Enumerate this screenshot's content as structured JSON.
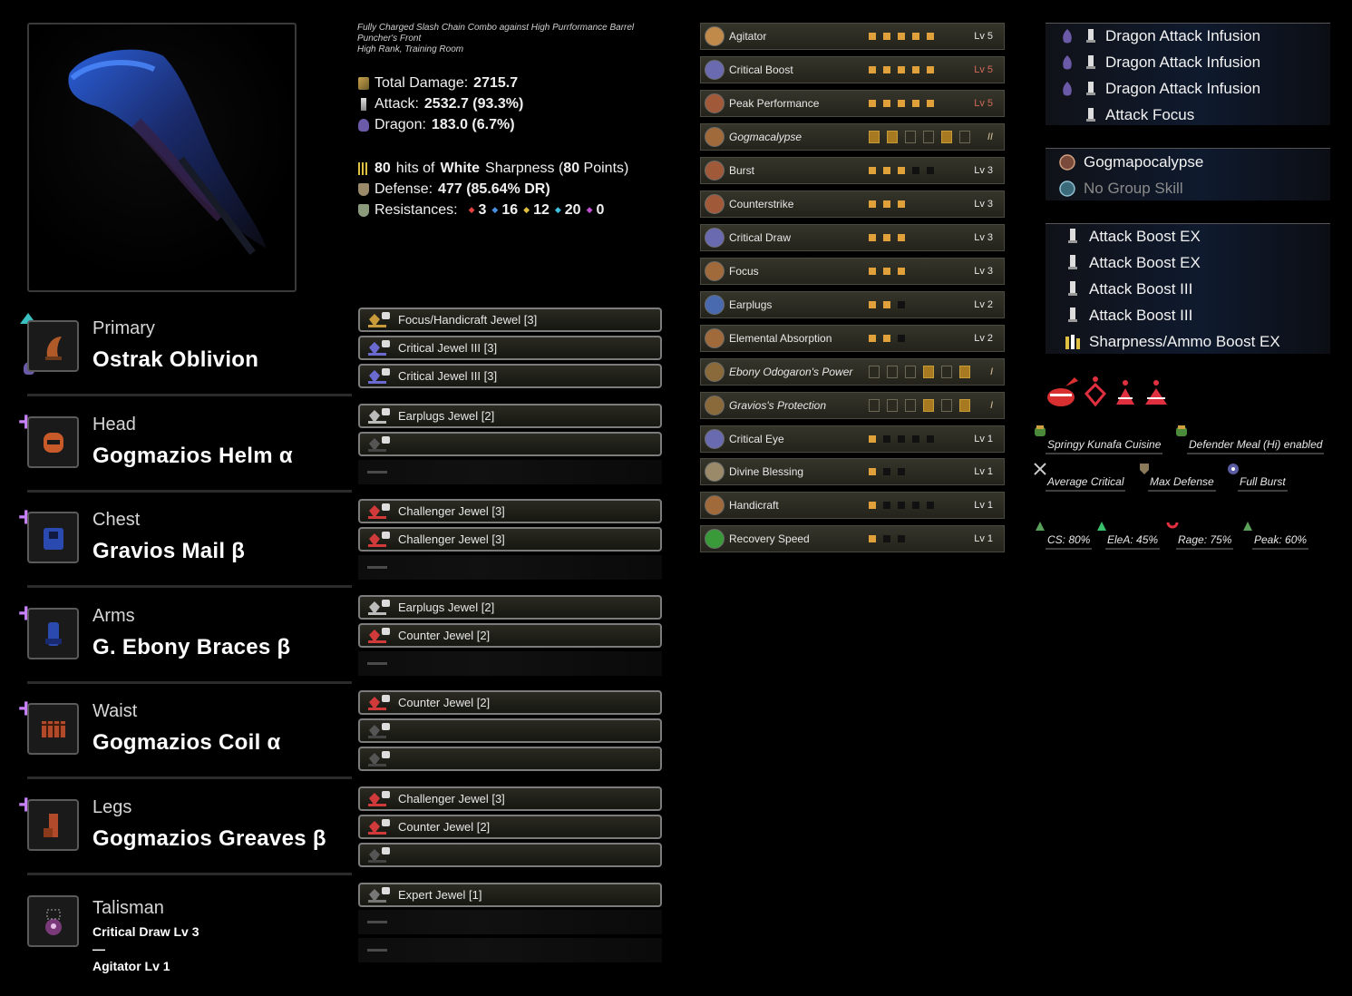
{
  "header": {
    "note_line1": "Fully Charged Slash Chain Combo against High Purrformance Barrel",
    "note_line2": "Puncher's Front",
    "note_line3": "High Rank, Training Room",
    "total_damage_label": "Total Damage:",
    "total_damage": "2715.7",
    "attack_label": "Attack:",
    "attack": "2532.7 (93.3%)",
    "dragon_label": "Dragon:",
    "dragon": "183.0 (6.7%)",
    "sharp_hits": "80",
    "sharp_text1": "hits of",
    "sharp_color": "White",
    "sharp_text2": "Sharpness (",
    "sharp_points": "80",
    "sharp_text3": "Points)",
    "defense_label": "Defense:",
    "defense": "477 (85.64% DR)",
    "resist_label": "Resistances:",
    "resists": [
      "3",
      "16",
      "12",
      "20",
      "0"
    ],
    "resist_colors": [
      "#e04040",
      "#4a90e0",
      "#e0c040",
      "#40c0e0",
      "#c050d0"
    ]
  },
  "equipment": [
    {
      "slot": "Primary",
      "name": "Ostrak Oblivion"
    },
    {
      "slot": "Head",
      "name": "Gogmazios Helm α"
    },
    {
      "slot": "Chest",
      "name": "Gravios Mail β"
    },
    {
      "slot": "Arms",
      "name": "G. Ebony Braces β"
    },
    {
      "slot": "Waist",
      "name": "Gogmazios Coil α"
    },
    {
      "slot": "Legs",
      "name": "Gogmazios Greaves β"
    }
  ],
  "talisman": {
    "slot": "Talisman",
    "skill1": "Critical Draw Lv 3",
    "dash": "—",
    "skill2": "Agitator Lv 1"
  },
  "jewels": [
    "Focus/Handicraft Jewel [3]",
    "Critical Jewel III [3]",
    "Critical Jewel III [3]",
    "Earplugs Jewel [2]",
    "",
    "Challenger Jewel [3]",
    "Challenger Jewel [3]",
    "Earplugs Jewel [2]",
    "Counter Jewel [2]",
    "Counter Jewel [2]",
    "",
    "",
    "Challenger Jewel [3]",
    "Counter Jewel [2]",
    "",
    "Expert Jewel [1]"
  ],
  "skills": [
    {
      "name": "Agitator",
      "pips": 5,
      "max": 5,
      "lv": "Lv 5",
      "maxed": false
    },
    {
      "name": "Critical Boost",
      "pips": 5,
      "max": 5,
      "lv": "Lv 5",
      "maxed": true
    },
    {
      "name": "Peak Performance",
      "pips": 5,
      "max": 5,
      "lv": "Lv 5",
      "maxed": true
    },
    {
      "name": "Gogmacalypse",
      "set": true,
      "lv": "II"
    },
    {
      "name": "Burst",
      "pips": 3,
      "max": 5,
      "lv": "Lv 3",
      "maxed": false
    },
    {
      "name": "Counterstrike",
      "pips": 3,
      "max": 3,
      "lv": "Lv 3",
      "maxed": true
    },
    {
      "name": "Critical Draw",
      "pips": 3,
      "max": 3,
      "lv": "Lv 3",
      "maxed": true
    },
    {
      "name": "Focus",
      "pips": 3,
      "max": 3,
      "lv": "Lv 3",
      "maxed": true
    },
    {
      "name": "Earplugs",
      "pips": 2,
      "max": 3,
      "lv": "Lv 2",
      "maxed": false
    },
    {
      "name": "Elemental Absorption",
      "pips": 2,
      "max": 3,
      "lv": "Lv 2",
      "maxed": false
    },
    {
      "name": "Ebony Odogaron's Power",
      "set": true,
      "lv": "I"
    },
    {
      "name": "Gravios's Protection",
      "set": true,
      "lv": "I"
    },
    {
      "name": "Critical Eye",
      "pips": 1,
      "max": 5,
      "lv": "Lv 1",
      "maxed": false
    },
    {
      "name": "Divine Blessing",
      "pips": 1,
      "max": 3,
      "lv": "Lv 1",
      "maxed": false
    },
    {
      "name": "Handicraft",
      "pips": 1,
      "max": 5,
      "lv": "Lv 1",
      "maxed": false
    },
    {
      "name": "Recovery Speed",
      "pips": 1,
      "max": 3,
      "lv": "Lv 1",
      "maxed": false
    }
  ],
  "decorations": [
    "Dragon Attack Infusion",
    "Dragon Attack Infusion",
    "Dragon Attack Infusion",
    "Attack Focus"
  ],
  "group_skills": [
    "Gogmapocalypse",
    "No Group Skill"
  ],
  "boosts": [
    "Attack Boost EX",
    "Attack Boost EX",
    "Attack Boost III",
    "Attack Boost III",
    "Sharpness/Ammo Boost EX"
  ],
  "buffs": {
    "food1": "Springy Kunafa Cuisine",
    "food2": "Defender Meal (Hi) enabled",
    "b1": "Average Critical",
    "b2": "Max Defense",
    "b3": "Full Burst",
    "c1": "CS: 80%",
    "c2": "EleA: 45%",
    "c3": "Rage: 75%",
    "c4": "Peak: 60%"
  }
}
